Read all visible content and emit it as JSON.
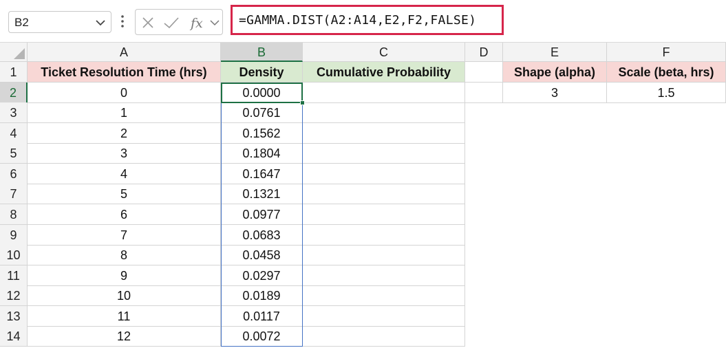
{
  "formula_bar": {
    "name_box": "B2",
    "formula": "=GAMMA.DIST(A2:A14,E2,F2,FALSE)"
  },
  "columns": [
    "A",
    "B",
    "C",
    "D",
    "E",
    "F"
  ],
  "selected_column": "B",
  "selected_row": "2",
  "rows": [
    "1",
    "2",
    "3",
    "4",
    "5",
    "6",
    "7",
    "8",
    "9",
    "10",
    "11",
    "12",
    "13",
    "14"
  ],
  "headers": {
    "a1": "Ticket Resolution Time (hrs)",
    "b1": "Density",
    "c1": "Cumulative Probability",
    "e1": "Shape (alpha)",
    "f1": "Scale (beta, hrs)"
  },
  "params": {
    "e2": "3",
    "f2": "1.5"
  },
  "time_values": [
    "0",
    "1",
    "2",
    "3",
    "4",
    "5",
    "6",
    "7",
    "8",
    "9",
    "10",
    "11",
    "12"
  ],
  "density_values": [
    "0.0000",
    "0.0761",
    "0.1562",
    "0.1804",
    "0.1647",
    "0.1321",
    "0.0977",
    "0.0683",
    "0.0458",
    "0.0297",
    "0.0189",
    "0.0117",
    "0.0072"
  ],
  "colors": {
    "header_pink": "#f8d7d5",
    "header_green": "#d9ead0",
    "formula_border": "#d6254a",
    "selection": "#1d7044"
  }
}
